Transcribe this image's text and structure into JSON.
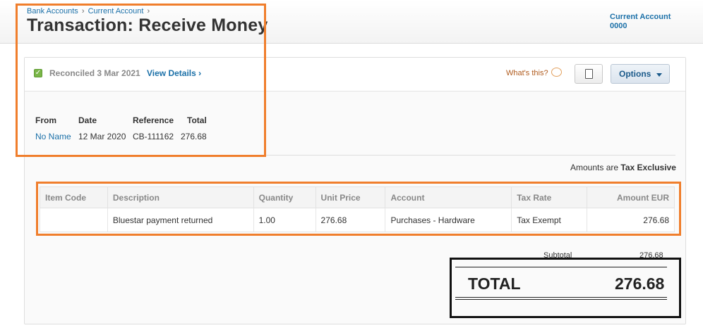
{
  "breadcrumb": {
    "bank_accounts": "Bank Accounts",
    "current_account": "Current Account",
    "sep": "›"
  },
  "title": "Transaction: Receive Money",
  "account": {
    "name": "Current Account",
    "number": "0000"
  },
  "status": {
    "reconciled": "Reconciled 3 Mar 2021",
    "view_details": "View Details ›",
    "whats_this": "What's this?",
    "options": "Options"
  },
  "summary": {
    "headers": {
      "from": "From",
      "date": "Date",
      "reference": "Reference",
      "total": "Total"
    },
    "from": "No Name",
    "date": "12 Mar 2020",
    "reference": "CB-111162",
    "total": "276.68"
  },
  "amounts_note": {
    "prefix": "Amounts are",
    "mode": "Tax Exclusive"
  },
  "table": {
    "headers": [
      "Item Code",
      "Description",
      "Quantity",
      "Unit Price",
      "Account",
      "Tax Rate",
      "Amount EUR"
    ],
    "rows": [
      [
        "",
        "Bluestar payment returned",
        "1.00",
        "276.68",
        "Purchases - Hardware",
        "Tax Exempt",
        "276.68"
      ]
    ]
  },
  "totals": {
    "subtotal_label": "Subtotal",
    "subtotal": "276.68",
    "total_label": "TOTAL",
    "total": "276.68"
  },
  "colors": {
    "link": "#1b70a8",
    "highlight_orange": "#f07e2c",
    "highlight_black": "#111111",
    "reconciled_check": "#7ab648"
  }
}
